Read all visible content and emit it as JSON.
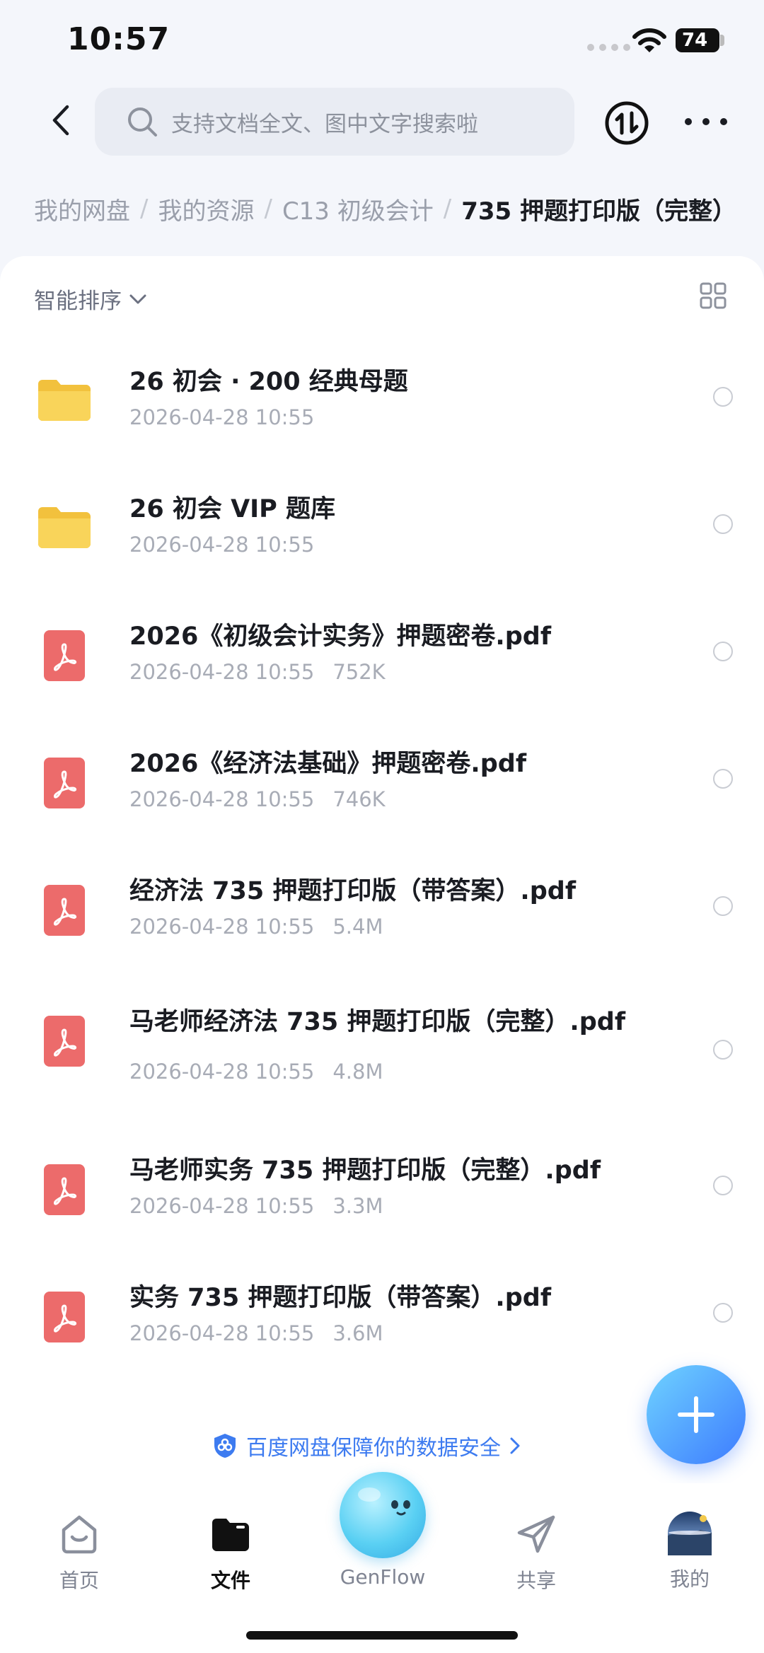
{
  "status_bar": {
    "time": "10:57",
    "battery": "74"
  },
  "search": {
    "placeholder": "支持文档全文、图中文字搜索啦"
  },
  "breadcrumb": {
    "items": [
      "我的网盘",
      "我的资源",
      "C13 初级会计"
    ],
    "current": "735 押题打印版（完整）"
  },
  "toolbar": {
    "sort_label": "智能排序"
  },
  "files": [
    {
      "type": "folder",
      "name": "26 初会 · 200 经典母题",
      "date": "2026-04-28 10:55",
      "size": ""
    },
    {
      "type": "folder",
      "name": "26 初会 VIP 题库",
      "date": "2026-04-28 10:55",
      "size": ""
    },
    {
      "type": "pdf",
      "name": "2026《初级会计实务》押题密卷.pdf",
      "date": "2026-04-28 10:55",
      "size": "752K"
    },
    {
      "type": "pdf",
      "name": "2026《经济法基础》押题密卷.pdf",
      "date": "2026-04-28 10:55",
      "size": "746K"
    },
    {
      "type": "pdf",
      "name": "经济法 735 押题打印版（带答案）.pdf",
      "date": "2026-04-28 10:55",
      "size": "5.4M"
    },
    {
      "type": "pdf",
      "name": "马老师经济法 735 押题打印版（完整）.pdf",
      "date": "2026-04-28 10:55",
      "size": "4.8M"
    },
    {
      "type": "pdf",
      "name": "马老师实务 735 押题打印版（完整）.pdf",
      "date": "2026-04-28 10:55",
      "size": "3.3M"
    },
    {
      "type": "pdf",
      "name": "实务 735 押题打印版（带答案）.pdf",
      "date": "2026-04-28 10:55",
      "size": "3.6M"
    }
  ],
  "security_notice": "百度网盘保障你的数据安全",
  "colors": {
    "accent": "#3d7bf0",
    "folder": "#f7c948",
    "pdf": "#ec6b6b"
  },
  "nav": {
    "home": "首页",
    "files": "文件",
    "genflow": "GenFlow",
    "share": "共享",
    "mine": "我的",
    "active": "files"
  }
}
